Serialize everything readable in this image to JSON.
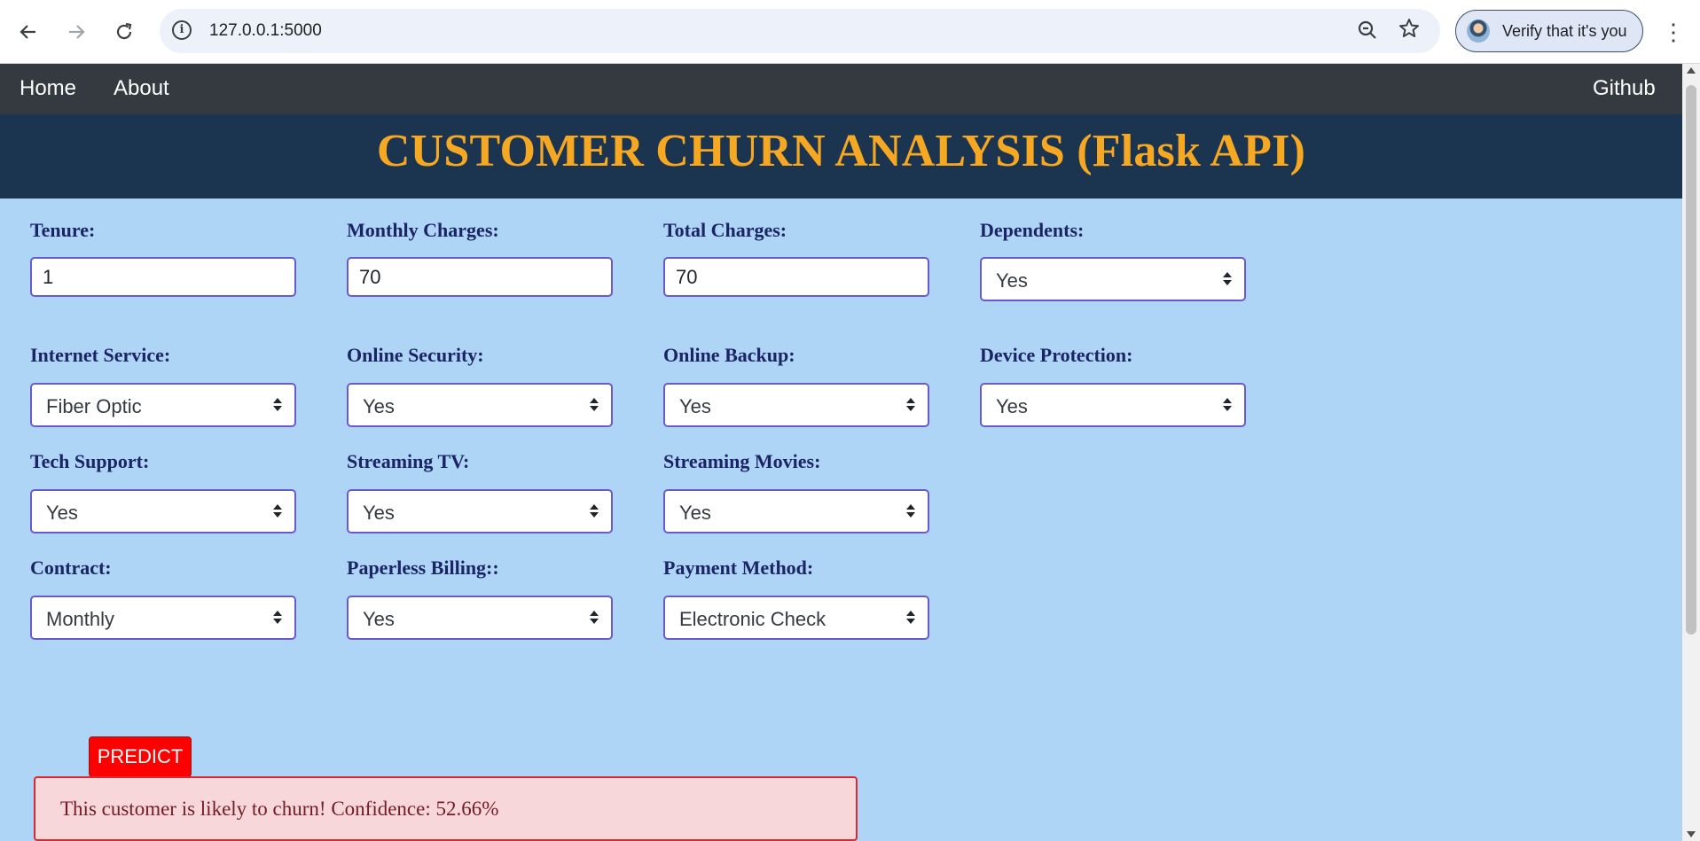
{
  "browser": {
    "url": "127.0.0.1:5000",
    "profile_label": "Verify that it's you",
    "icons": {
      "back": "arrow-left-icon",
      "forward": "arrow-right-icon",
      "reload": "reload-icon",
      "site_info": "info-icon",
      "zoom": "zoom-icon",
      "bookmark": "star-icon",
      "menu": "kebab-menu-icon"
    }
  },
  "nav": {
    "home": "Home",
    "about": "About",
    "github": "Github"
  },
  "banner": {
    "title": "CUSTOMER CHURN ANALYSIS (Flask API)"
  },
  "form": {
    "tenure": {
      "label": "Tenure:",
      "value": "1"
    },
    "monthly_charges": {
      "label": "Monthly Charges:",
      "value": "70"
    },
    "total_charges": {
      "label": "Total Charges:",
      "value": "70"
    },
    "dependents": {
      "label": "Dependents:",
      "value": "Yes"
    },
    "internet_service": {
      "label": "Internet Service:",
      "value": "Fiber Optic"
    },
    "online_security": {
      "label": "Online Security:",
      "value": "Yes"
    },
    "online_backup": {
      "label": "Online Backup:",
      "value": "Yes"
    },
    "device_protection": {
      "label": "Device Protection:",
      "value": "Yes"
    },
    "tech_support": {
      "label": "Tech Support:",
      "value": "Yes"
    },
    "streaming_tv": {
      "label": "Streaming TV:",
      "value": "Yes"
    },
    "streaming_movies": {
      "label": "Streaming Movies:",
      "value": "Yes"
    },
    "contract": {
      "label": "Contract:",
      "value": "Monthly"
    },
    "paperless_billing": {
      "label": "Paperless Billing::",
      "value": "Yes"
    },
    "payment_method": {
      "label": "Payment Method:",
      "value": "Electronic Check"
    }
  },
  "predict_label": "PREDICT",
  "result": "This customer is likely to churn! Confidence: 52.66%",
  "colors": {
    "navbar": "#343a40",
    "banner_bg": "#1b344f",
    "banner_title": "#f7a823",
    "page_bg": "#aed5f5",
    "field_border": "#6a5acd",
    "predict_button": "#ff0000",
    "alert_bg": "#f8d7da",
    "alert_border": "#e0262e"
  }
}
